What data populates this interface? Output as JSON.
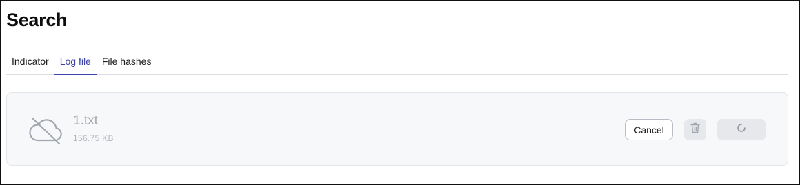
{
  "page": {
    "title": "Search"
  },
  "tabs": [
    {
      "label": "Indicator",
      "active": false
    },
    {
      "label": "Log file",
      "active": true
    },
    {
      "label": "File hashes",
      "active": false
    }
  ],
  "upload": {
    "file_name": "1.txt",
    "file_size": "156.75 KB",
    "status_icon": "cloud-off-icon",
    "cancel_label": "Cancel",
    "delete_icon": "trash-icon",
    "progress_icon": "spinner-icon"
  },
  "colors": {
    "accent": "#3b43a8",
    "card_background": "#f7f8fa",
    "muted_text": "#a5a9b2",
    "tab_border": "#dcdde2"
  }
}
